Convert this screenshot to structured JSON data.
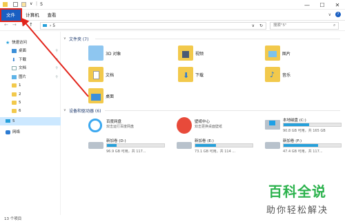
{
  "titlebar": {
    "path": "5",
    "sep": "|",
    "minimize": "—",
    "maximize": "☐",
    "close": "✕"
  },
  "ribbon": {
    "tabs": [
      "文件",
      "计算机",
      "查看"
    ]
  },
  "address": {
    "path": "5",
    "search_placeholder": "搜索\"5\""
  },
  "sidebar": {
    "quick_access": "快速访问",
    "items": [
      {
        "label": "桌面",
        "icon": "desktop-folder-icon",
        "pinned": true
      },
      {
        "label": "下载",
        "icon": "download-folder-icon",
        "pinned": true
      },
      {
        "label": "文档",
        "icon": "documents-folder-icon",
        "pinned": true
      },
      {
        "label": "图片",
        "icon": "pictures-folder-icon",
        "pinned": true
      },
      {
        "label": "1",
        "icon": "folder-icon",
        "pinned": false
      },
      {
        "label": "2",
        "icon": "folder-icon",
        "pinned": false
      },
      {
        "label": "5",
        "icon": "folder-icon",
        "pinned": false
      },
      {
        "label": "6",
        "icon": "folder-icon",
        "pinned": false
      }
    ],
    "this_pc": "5",
    "network": "网络"
  },
  "folders": {
    "header": "文件夹 (7)",
    "items": [
      "3D 对象",
      "视频",
      "图片",
      "文档",
      "下载",
      "音乐",
      "桌面"
    ]
  },
  "devices": {
    "header": "设备和驱动器 (6)",
    "items": [
      {
        "name": "百度网盘",
        "sub": "双击运行百度网盘",
        "icon": "baidu-netdisk-icon"
      },
      {
        "name": "壁纸中心",
        "sub": "双击更换桌面壁纸",
        "icon": "wallpaper-center-icon"
      },
      {
        "name": "本地磁盘 (C:)",
        "free": "90.8 GB 可用，共 165 GB",
        "used_fraction": 0.45,
        "icon": "windows-drive-icon"
      },
      {
        "name": "新加卷 (D:)",
        "free": "96.9 GB 可用，共 117...",
        "used_fraction": 0.17,
        "icon": "drive-icon"
      },
      {
        "name": "新加卷 (E:)",
        "free": "73.1 GB 可用，共 114 ...",
        "used_fraction": 0.36,
        "icon": "drive-icon"
      },
      {
        "name": "新加卷 (F:)",
        "free": "47.4 GB 可用，共 117...",
        "used_fraction": 0.6,
        "icon": "drive-icon"
      }
    ]
  },
  "status": {
    "count": "13 个项目"
  },
  "watermark": {
    "title": "百科全说",
    "subtitle": "助你轻松解决"
  },
  "colors": {
    "accent": "#1a5fc2",
    "annotation": "#e2231a",
    "bar": "#26a0da",
    "watermark": "#2bb24c"
  }
}
